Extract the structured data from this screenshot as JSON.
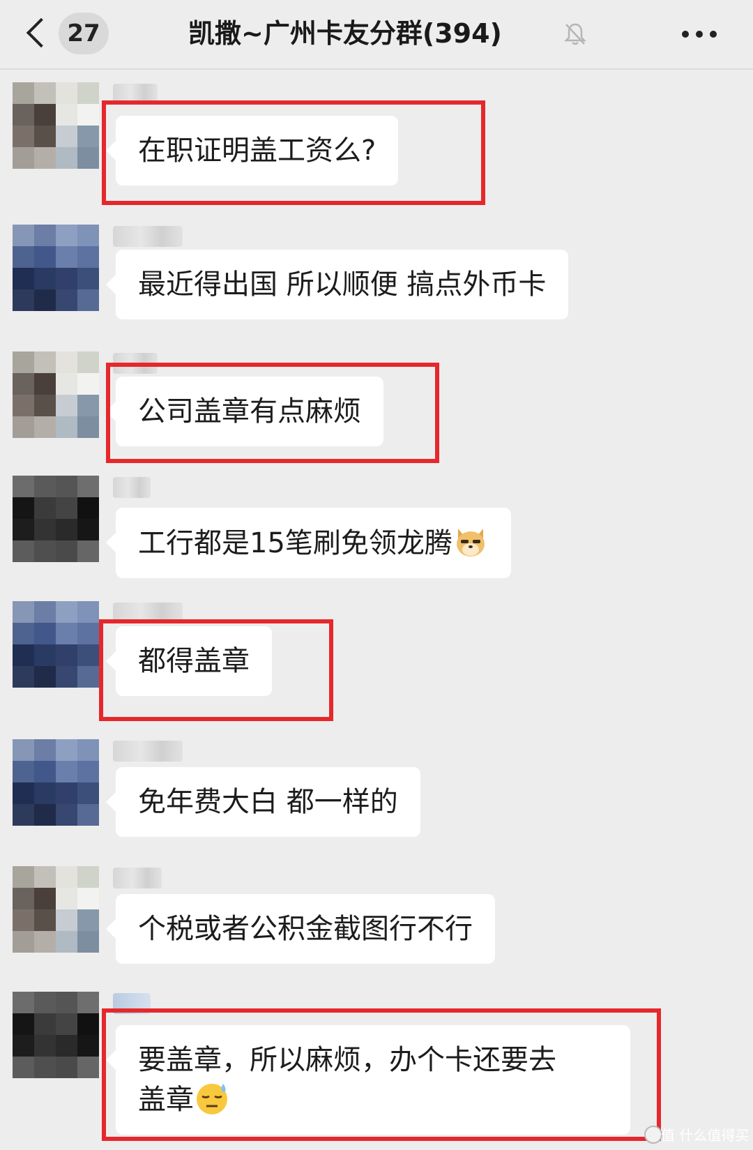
{
  "header": {
    "unread_count": "27",
    "title": "凯撒~广州卡友分群(394)",
    "back_icon": "chevron-left-icon",
    "mute_icon": "bell-off-icon",
    "more_icon": "more-dots-icon"
  },
  "messages": [
    {
      "text": "在职证明盖工资么?",
      "highlighted": true
    },
    {
      "text": "最近得出国 所以顺便 搞点外币卡",
      "highlighted": false
    },
    {
      "text": "公司盖章有点麻烦",
      "highlighted": true
    },
    {
      "text": "工行都是15笔刷免领龙腾",
      "emoji": "doge-emoji",
      "highlighted": false
    },
    {
      "text": "都得盖章",
      "highlighted": true
    },
    {
      "text": "免年费大白 都一样的",
      "highlighted": false
    },
    {
      "text": "个税或者公积金截图行不行",
      "highlighted": false
    },
    {
      "text_line1": "要盖章，所以麻烦，办个卡还要去",
      "text_line2": "盖章",
      "emoji": "sweat-smile-emoji",
      "highlighted": true
    }
  ],
  "watermark": "值 什么值得买",
  "colors": {
    "background": "#ededed",
    "bubble": "#ffffff",
    "highlight_box": "#e5282c"
  }
}
